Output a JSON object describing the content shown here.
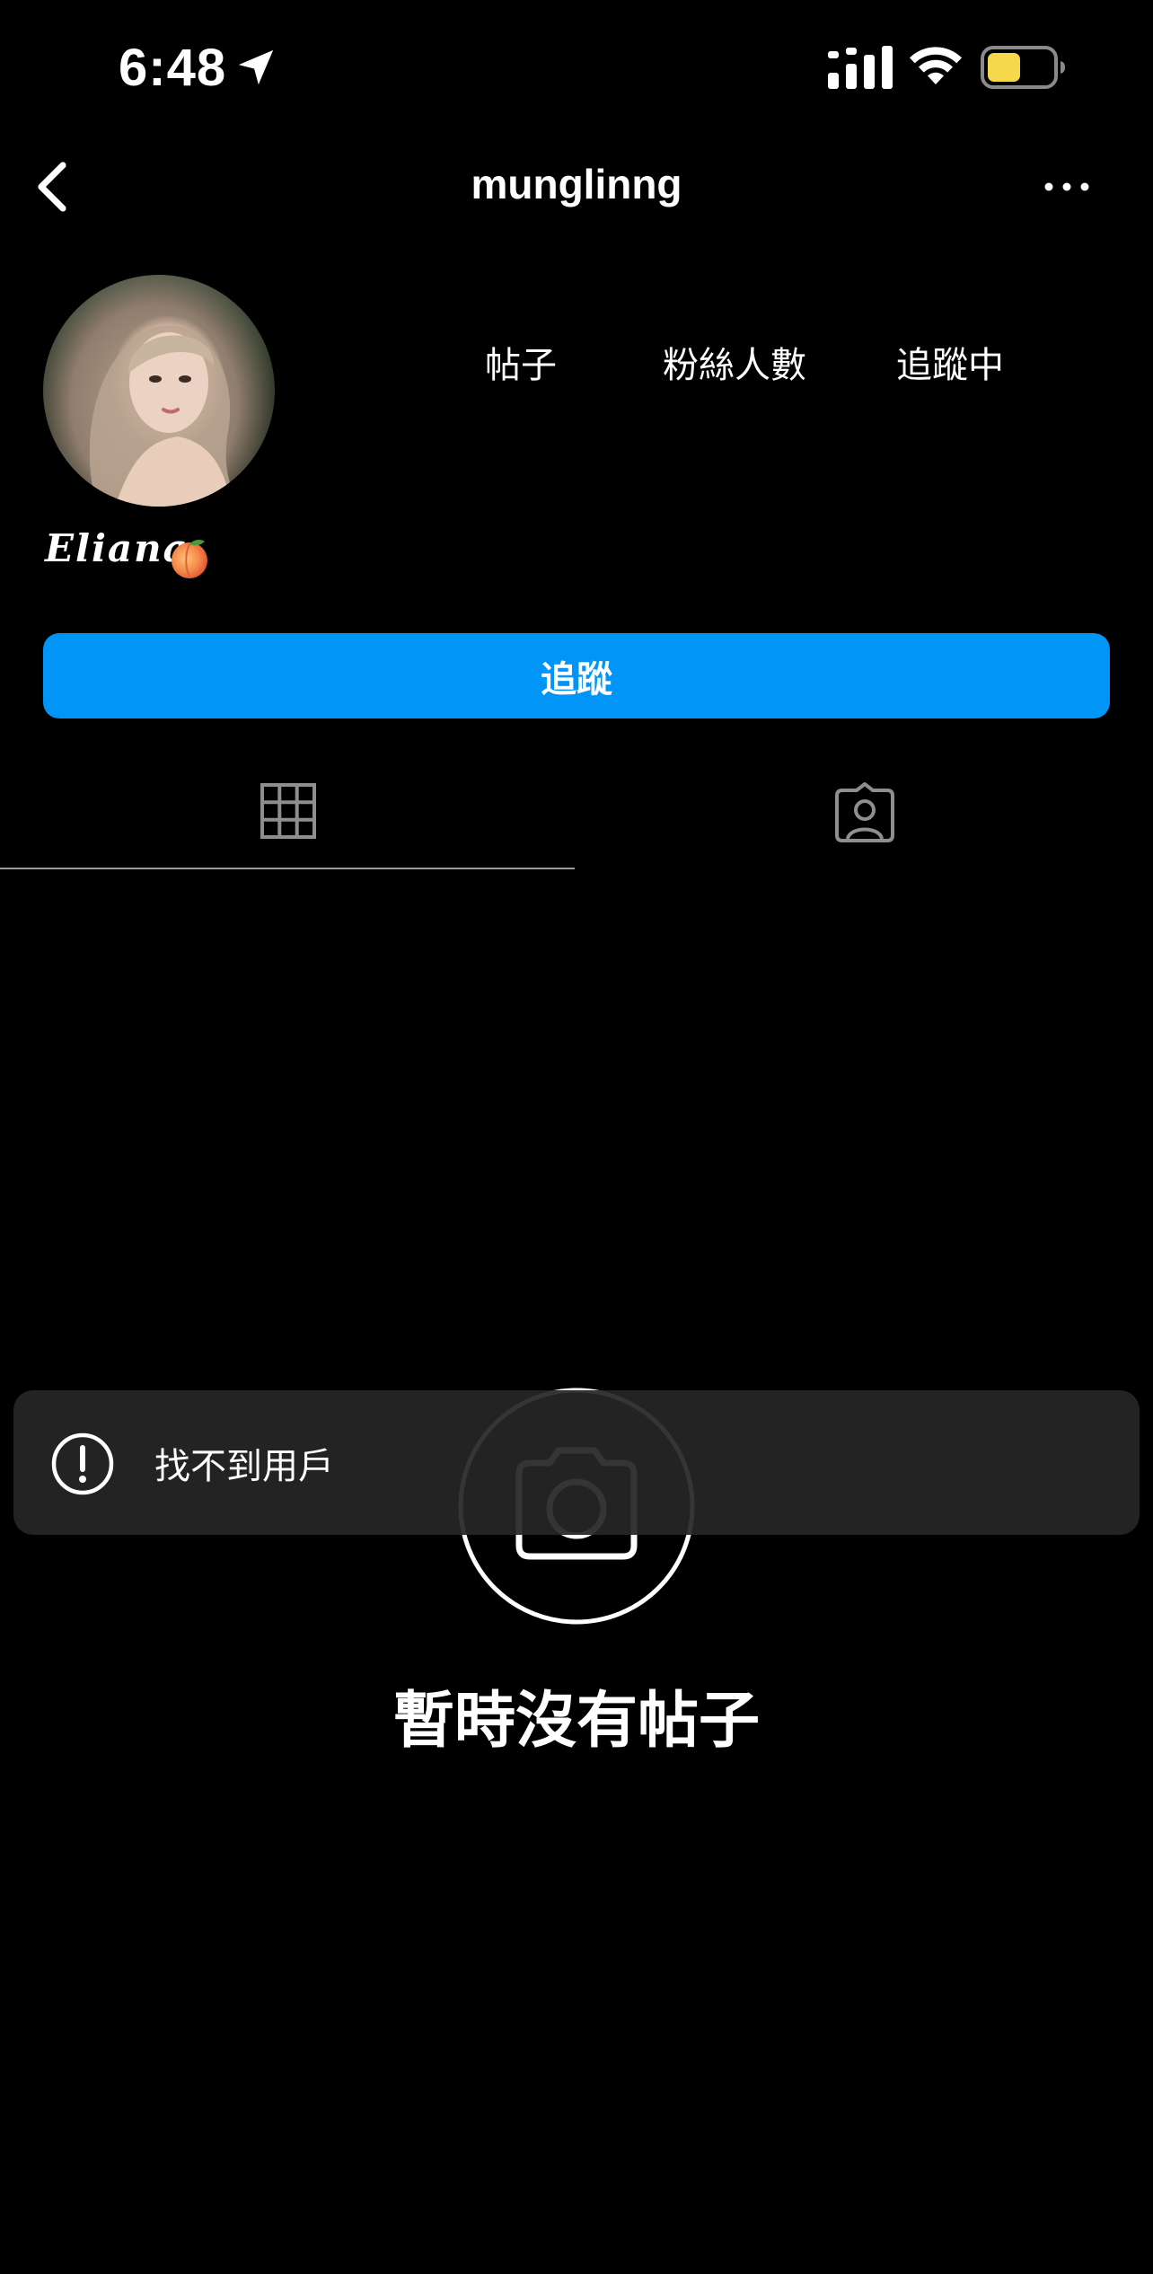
{
  "status_bar": {
    "time": "6:48",
    "icons": [
      "location-arrow-icon",
      "signal-icon",
      "wifi-icon",
      "battery-icon"
    ],
    "battery_color": "#f6d84a"
  },
  "header": {
    "username": "munglinng",
    "back_icon": "chevron-left-icon",
    "more_icon": "more-horizontal-icon"
  },
  "profile": {
    "display_name": "Eliana",
    "stats": {
      "posts_label": "帖子",
      "followers_label": "粉絲人數",
      "following_label": "追蹤中"
    },
    "follow_button": "追蹤",
    "follow_button_color": "#0095f6"
  },
  "tabs": [
    {
      "icon": "grid-icon",
      "active": true
    },
    {
      "icon": "tagged-person-icon",
      "active": false
    }
  ],
  "empty_state": {
    "icon": "camera-icon",
    "title": "暫時沒有帖子"
  },
  "toast": {
    "icon": "exclamation-circle-icon",
    "message": "找不到用戶"
  }
}
